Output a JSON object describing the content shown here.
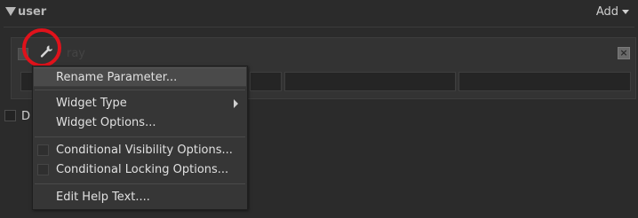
{
  "header": {
    "title": "user",
    "add_label": "Add"
  },
  "param_block": {
    "label_partial": "ray",
    "row_label_partial": "ne",
    "close_glyph": "×"
  },
  "checkbox_left": {
    "label_partial": "D"
  },
  "context_menu": {
    "items": [
      {
        "label": "Rename Parameter...",
        "highlighted": true
      },
      {
        "label": "Widget Type",
        "has_submenu": true
      },
      {
        "label": "Widget Options..."
      },
      {
        "label": "Conditional Visibility Options...",
        "checkbox": true
      },
      {
        "label": "Conditional Locking Options...",
        "checkbox": true
      },
      {
        "label": "Edit Help Text...."
      }
    ]
  },
  "annotation": {
    "color": "#e0121b",
    "target_icon": "wrench-icon"
  }
}
